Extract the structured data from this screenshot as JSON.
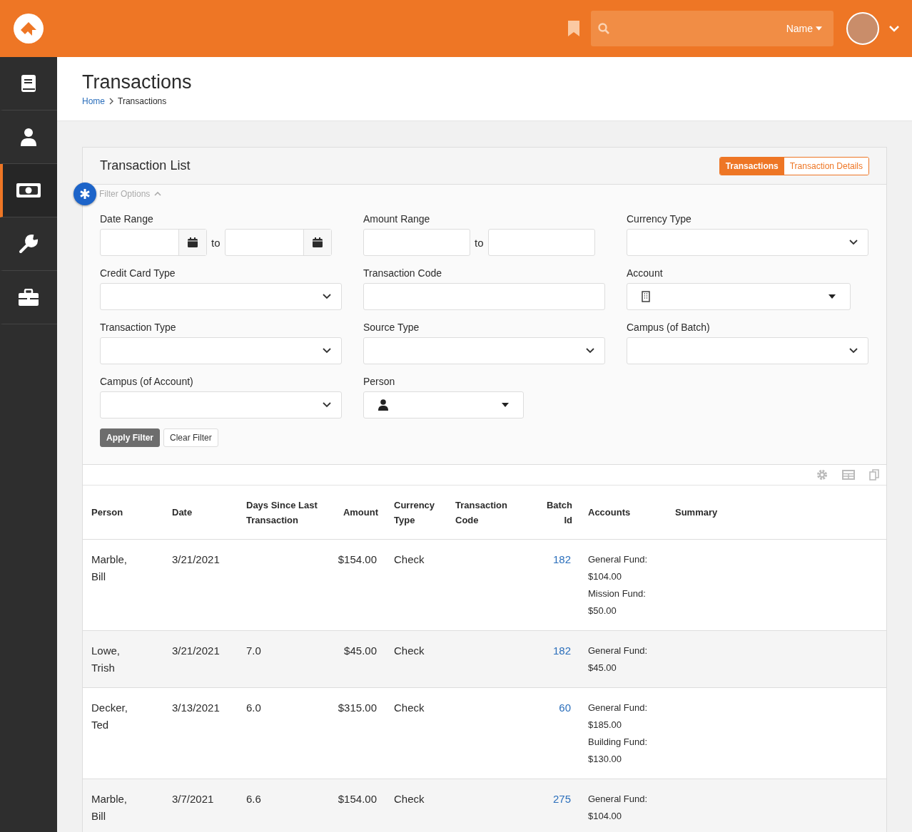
{
  "header": {
    "search": {
      "scope": "Name"
    }
  },
  "sidebar": {
    "items": [
      {
        "selected": false
      },
      {
        "selected": false
      },
      {
        "selected": true
      },
      {
        "selected": false
      },
      {
        "selected": false
      }
    ]
  },
  "page": {
    "title": "Transactions",
    "breadcrumb": [
      "Home",
      "Transactions"
    ]
  },
  "panel": {
    "title": "Transaction List",
    "tabs": [
      {
        "label": "Transactions",
        "selected": true
      },
      {
        "label": "Transaction Details",
        "selected": false
      }
    ],
    "filter": {
      "toggle": "Filter Options",
      "expanded": true,
      "fields": [
        {
          "label": "Date Range",
          "kind": "date_range",
          "separator": "to"
        },
        {
          "label": "Amount Range",
          "kind": "amount_range",
          "separator": "to"
        },
        {
          "label": "Currency Type",
          "kind": "select"
        },
        {
          "label": "Credit Card Type",
          "kind": "select"
        },
        {
          "label": "Transaction Code",
          "kind": "text"
        },
        {
          "label": "Account",
          "kind": "account_picker"
        },
        {
          "label": "Transaction Type",
          "kind": "select"
        },
        {
          "label": "Source Type",
          "kind": "select"
        },
        {
          "label": "Campus (of Batch)",
          "kind": "select"
        },
        {
          "label": "Campus (of Account)",
          "kind": "select"
        },
        {
          "label": "Person",
          "kind": "person_picker"
        }
      ],
      "buttons": [
        {
          "label": "Apply Filter",
          "kind": "primary"
        },
        {
          "label": "Clear Filter",
          "kind": "default"
        }
      ]
    },
    "table": {
      "columns": [
        "Person",
        "Date",
        "Days Since Last Transaction",
        "Amount",
        "Currency Type",
        "Transaction Code",
        "Batch Id",
        "Accounts",
        "Summary"
      ],
      "rows": [
        {
          "person": "Marble, Bill",
          "date": "3/21/2021",
          "amount": "$154.00",
          "currency": "Check",
          "batch_id": "182",
          "accounts": [
            {
              "fund": "General Fund:",
              "amount": "$104.00"
            },
            {
              "fund": "Mission Fund:",
              "amount": "$50.00"
            }
          ]
        },
        {
          "person": "Lowe, Trish",
          "date": "3/21/2021",
          "days": "7.0",
          "amount": "$45.00",
          "currency": "Check",
          "batch_id": "182",
          "accounts": [
            {
              "fund": "General Fund:",
              "amount": "$45.00"
            }
          ]
        },
        {
          "person": "Decker, Ted",
          "date": "3/13/2021",
          "days": "6.0",
          "amount": "$315.00",
          "currency": "Check",
          "batch_id": "60",
          "accounts": [
            {
              "fund": "General Fund:",
              "amount": "$185.00"
            },
            {
              "fund": "Building Fund:",
              "amount": "$130.00"
            }
          ]
        },
        {
          "person": "Marble, Bill",
          "date": "3/7/2021",
          "days": "6.6",
          "amount": "$154.00",
          "currency": "Check",
          "batch_id": "275",
          "accounts": [
            {
              "fund": "General Fund:",
              "amount": "$104.00"
            }
          ]
        }
      ]
    }
  }
}
